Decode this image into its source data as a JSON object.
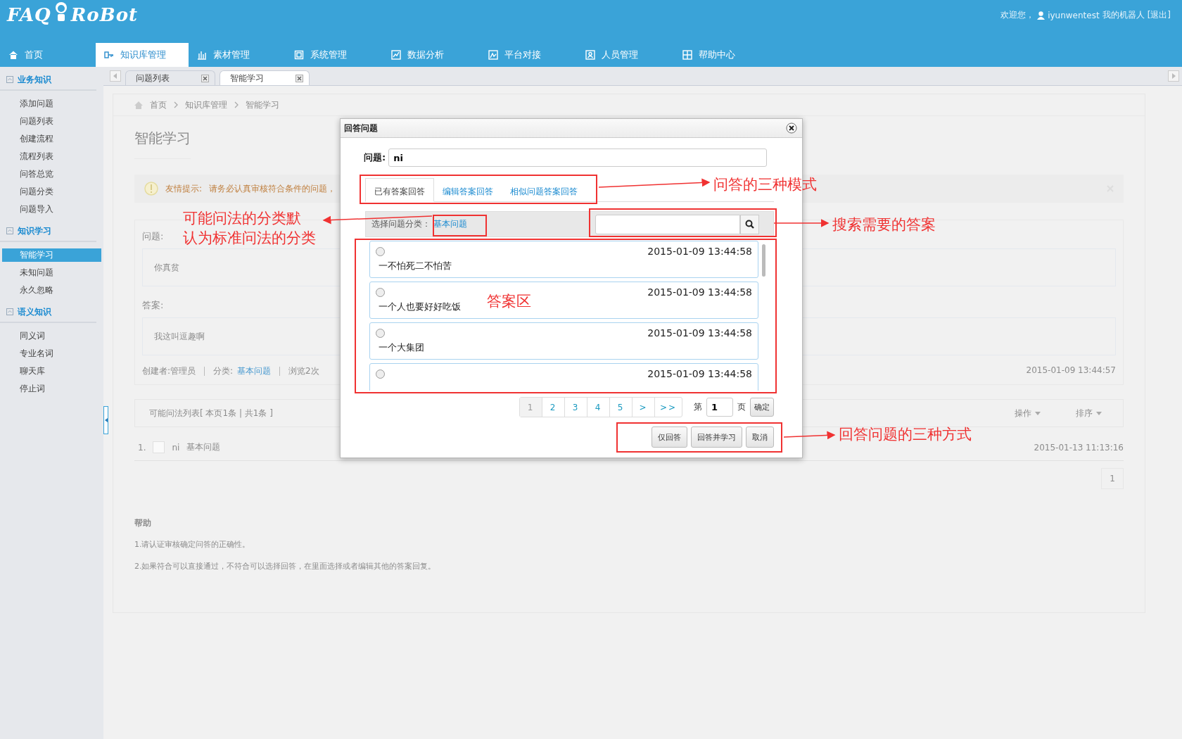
{
  "header": {
    "logo_left": "FAQ",
    "logo_right": "RoBot",
    "welcome": "欢迎您，",
    "user": "iyunwentest",
    "robot_link": "我的机器人",
    "logout": "[退出]"
  },
  "nav": [
    {
      "label": "首页",
      "selected": false
    },
    {
      "label": "知识库管理",
      "selected": true
    },
    {
      "label": "素材管理",
      "selected": false
    },
    {
      "label": "系统管理",
      "selected": false
    },
    {
      "label": "数据分析",
      "selected": false
    },
    {
      "label": "平台对接",
      "selected": false
    },
    {
      "label": "人员管理",
      "selected": false
    },
    {
      "label": "帮助中心",
      "selected": false
    }
  ],
  "sidebar": [
    {
      "title": "业务知识",
      "items": [
        {
          "label": "添加问题",
          "selected": false
        },
        {
          "label": "问题列表",
          "selected": false
        },
        {
          "label": "创建流程",
          "selected": false
        },
        {
          "label": "流程列表",
          "selected": false
        },
        {
          "label": "问答总览",
          "selected": false
        },
        {
          "label": "问题分类",
          "selected": false
        },
        {
          "label": "问题导入",
          "selected": false
        }
      ]
    },
    {
      "title": "知识学习",
      "items": [
        {
          "label": "智能学习",
          "selected": true
        },
        {
          "label": "未知问题",
          "selected": false
        },
        {
          "label": "永久忽略",
          "selected": false
        }
      ]
    },
    {
      "title": "语义知识",
      "items": [
        {
          "label": "同义词",
          "selected": false
        },
        {
          "label": "专业名词",
          "selected": false
        },
        {
          "label": "聊天库",
          "selected": false
        },
        {
          "label": "停止词",
          "selected": false
        }
      ]
    }
  ],
  "page_tabs": [
    {
      "label": "问题列表",
      "selected": false
    },
    {
      "label": "智能学习",
      "selected": true
    }
  ],
  "page": {
    "breadcrumb": [
      "首页",
      "知识库管理",
      "智能学习"
    ],
    "title": "智能学习",
    "alert": {
      "label": "友情提示:",
      "message": "请务必认真审核符合条件的问题，"
    },
    "question_label": "问题:",
    "question": "你真贫",
    "answer_label": "答案:",
    "answer": "我这叫逗趣啊",
    "meta": {
      "creator": "创建者:管理员",
      "category_label": "分类:",
      "category": "基本问题",
      "views": "浏览2次",
      "date": "2015-01-09 13:44:57"
    },
    "list": {
      "summary": "可能问法列表[  本页1条 | 共1条  ]",
      "actions": [
        "操作",
        "排序"
      ],
      "rows": [
        {
          "index": "1.",
          "checked": false,
          "text": "ni",
          "category": "基本问题",
          "date": "2015-01-13 11:13:16"
        }
      ],
      "pages": [
        "1"
      ]
    },
    "help": {
      "title": "帮助",
      "lines": [
        "1.请认证审核确定问答的正确性。",
        "2.如果符合可以直接通过，不符合可以选择回答，在里面选择或者编辑其他的答案回复。"
      ]
    }
  },
  "dialog": {
    "title": "回答问题",
    "question_label": "问题:",
    "question": "ni",
    "tabs": [
      {
        "label": "已有答案回答",
        "selected": true
      },
      {
        "label": "编辑答案回答",
        "selected": false
      },
      {
        "label": "相似问题答案回答",
        "selected": false
      }
    ],
    "category_label": "选择问题分类：",
    "category": "基本问题",
    "answers": [
      {
        "date": "2015-01-09 13:44:58",
        "text": "一不怕死二不怕苦",
        "selected": false
      },
      {
        "date": "2015-01-09 13:44:58",
        "text": "一个人也要好好吃饭",
        "selected": false
      },
      {
        "date": "2015-01-09 13:44:58",
        "text": "一个大集团",
        "selected": false
      },
      {
        "date": "2015-01-09 13:44:58",
        "selected": false
      }
    ],
    "pager": {
      "pages": [
        {
          "label": "1",
          "selected": true
        },
        {
          "label": "2",
          "selected": false
        },
        {
          "label": "3",
          "selected": false
        },
        {
          "label": "4",
          "selected": false
        },
        {
          "label": "5",
          "selected": false
        },
        {
          "label": ">",
          "selected": false
        },
        {
          "label": ">>",
          "selected": false
        }
      ],
      "before": "第",
      "page": "1",
      "after": "页",
      "go": "确定"
    },
    "buttons": [
      "仅回答",
      "回答并学习",
      "取消"
    ]
  },
  "annotations": [
    {
      "lines": [
        "问答的三种模式"
      ]
    },
    {
      "lines": [
        "搜索需要的答案"
      ]
    },
    {
      "lines": [
        "回答问题的三种方式"
      ]
    },
    {
      "lines": [
        "可能问法的分类默",
        "认为标准问法的分类"
      ]
    },
    {
      "lines": [
        "答案区"
      ]
    }
  ]
}
